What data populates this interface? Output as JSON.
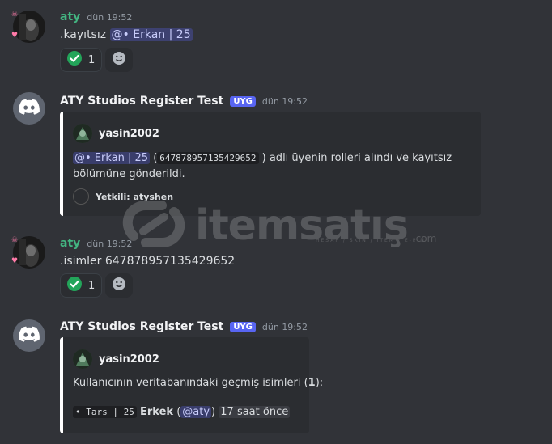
{
  "messages": [
    {
      "author": "aty",
      "time": "dün 19:52",
      "text_prefix": ".kayıtsız",
      "mention": "@• Erkan | 25",
      "reaction_count": "1"
    },
    {
      "author": "ATY Studios Register Test",
      "tag": "UYG",
      "time": "dün 19:52",
      "embed": {
        "author": "yasin2002",
        "mention": "@• Erkan | 25",
        "open_paren": "(",
        "id": "647878957135429652",
        "after_id": ") adlı üyenin rolleri alındı ve kayıtsız",
        "line2": "bölümüne gönderildi.",
        "footer": "Yetkili: atyshen"
      }
    },
    {
      "author": "aty",
      "time": "dün 19:52",
      "text": ".isimler 647878957135429652",
      "reaction_count": "1"
    },
    {
      "author": "ATY Studios Register Test",
      "tag": "UYG",
      "time": "dün 19:52",
      "embed": {
        "author": "yasin2002",
        "desc_prefix": "Kullanıcının veritabanındaki geçmiş isimleri (",
        "count": "1",
        "desc_suffix": "):",
        "entry_code": "• Tars | 25",
        "entry_gender": "Erkek",
        "entry_open": "(",
        "entry_mention": "@aty",
        "entry_close": ")",
        "entry_time": "17 saat önce"
      }
    }
  ],
  "watermark": {
    "text": "itemsatış",
    "sub": "HESAP / SKIN / ITEM / E-PIN",
    "domain": ".com"
  },
  "icons": {
    "check": "check-icon",
    "emoji": "add-reaction-icon",
    "discord": "discord-logo-icon"
  },
  "colors": {
    "background": "#313338",
    "username_green": "#43b581",
    "tag": "#5865f2",
    "reaction_check": "#23a55a"
  }
}
